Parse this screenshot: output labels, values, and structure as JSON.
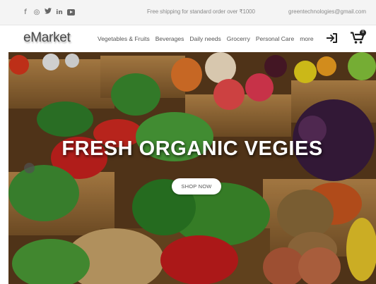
{
  "topbar": {
    "social_icons": [
      "facebook-icon",
      "instagram-icon",
      "twitter-icon",
      "linkedin-icon",
      "youtube-icon"
    ],
    "social_glyphs": {
      "facebook": "f",
      "instagram": "◎",
      "twitter": "🐦",
      "linkedin": "in"
    },
    "shipping_text": "Free shipping for standard order over ₹1000",
    "email": "greentechnologies@gmail.com"
  },
  "navbar": {
    "logo": "eMarket",
    "links": [
      "Vegetables & Fruits",
      "Beverages",
      "Daily needs",
      "Grocerry",
      "Personal Care",
      "more"
    ],
    "cart_count": "0"
  },
  "hero": {
    "title": "FRESH ORGANIC VEGIES",
    "button_label": "SHOP NOW"
  },
  "colors": {
    "topbar_bg": "#f4f4f4",
    "text_muted": "#8a8a8a",
    "hero_title": "#ffffff"
  }
}
